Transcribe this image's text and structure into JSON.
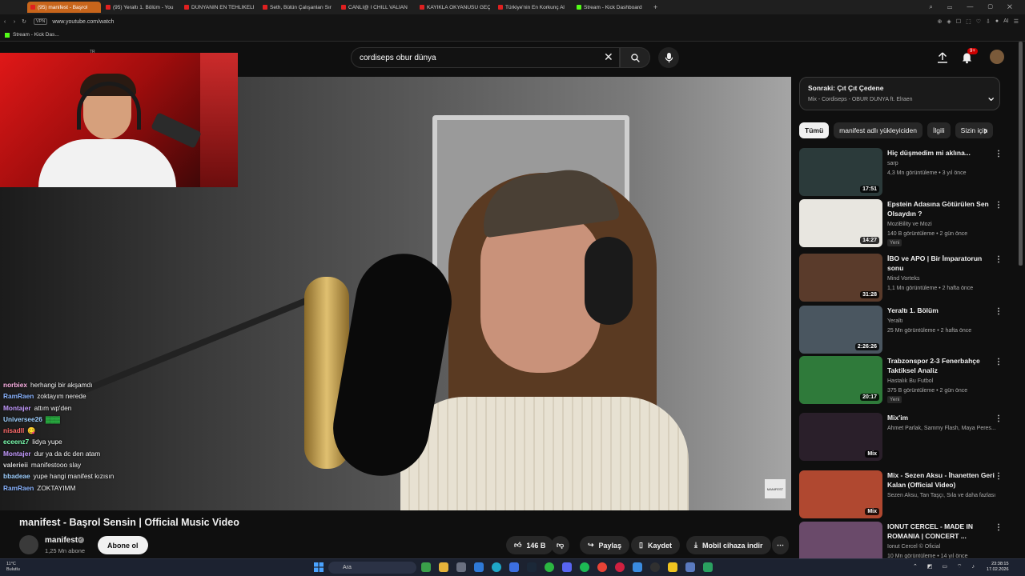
{
  "browser": {
    "tabs": [
      {
        "label": "(95) manifest - Başrol",
        "active": true,
        "favicon": "youtube-icon"
      },
      {
        "label": "(95) Yeraltı 1. Bölüm - You",
        "active": false,
        "favicon": "youtube-icon"
      },
      {
        "label": "DÜNYANIN EN TEHLİKELİ",
        "active": false,
        "favicon": "youtube-icon"
      },
      {
        "label": "Seth, Bütün Çalışanları Sır",
        "active": false,
        "favicon": "youtube-icon"
      },
      {
        "label": "CANLI@ I CHILL VALİAN",
        "active": false,
        "favicon": "youtube-icon"
      },
      {
        "label": "KAYIKLA OKYANUSU GEÇ",
        "active": false,
        "favicon": "youtube-icon"
      },
      {
        "label": "Türkiye'nin En Korkunç Al",
        "active": false,
        "favicon": "youtube-icon"
      },
      {
        "label": "Stream - Kick Dashboard",
        "active": false,
        "favicon": "kick-icon"
      }
    ],
    "vpn_label": "VPN",
    "url": "www.youtube.com/watch",
    "ai_label": "AI",
    "bookmark": "Stream - Kick Das..."
  },
  "masthead": {
    "country_code": "TR",
    "search_value": "cordiseps obur dünya",
    "notification_count": "9+"
  },
  "chat": [
    {
      "user": "norbiex",
      "color": "#ffb3e6",
      "message": "herhangi bir akşamdı"
    },
    {
      "user": "RamRaen",
      "color": "#8ab4ff",
      "message": "zoktayım nerede"
    },
    {
      "user": "Montajer",
      "color": "#c49bff",
      "message": "attım wp'den"
    },
    {
      "user": "Universee26",
      "color": "#9fd0ff",
      "message": "▓▓▓"
    },
    {
      "user": "nisadll",
      "color": "#ff6b6b",
      "message": "😋"
    },
    {
      "user": "eceenz7",
      "color": "#7cffb0",
      "message": "lidya yupe"
    },
    {
      "user": "Montajer",
      "color": "#c49bff",
      "message": "dur ya da dc den atam"
    },
    {
      "user": "valerieii",
      "color": "#d9d9d9",
      "message": "manifestooo slay"
    },
    {
      "user": "bbadeae",
      "color": "#9fd0ff",
      "message": "yupe hangi manifest kızısın"
    },
    {
      "user": "RamRaen",
      "color": "#8ab4ff",
      "message": "ZOKTAYIMM"
    }
  ],
  "video": {
    "title": "manifest - Başrol Sensin | Official Music Video",
    "watermark": "MANIFEST",
    "channel": "manifest",
    "subscribers": "1,25 Mn abone",
    "subscribe_label": "Abone ol",
    "likes": "146 B",
    "share_label": "Paylaş",
    "save_label": "Kaydet",
    "download_label": "Mobil cihaza indir"
  },
  "sidebar": {
    "next_title": "Sonraki: Çıt Çıt Çedene",
    "next_subtitle": "Mix - Cordiseps - OBUR DUNYA ft. Elraen",
    "chips": [
      "Tümü",
      "manifest adlı yükleyiciden",
      "İlgili",
      "Sizin için"
    ],
    "recommendations": [
      {
        "title": "Hiç düşmedim mi aklına...",
        "channel": "sarp",
        "meta": "4,3 Mn görüntüleme • 3 yıl önce",
        "duration": "17:51",
        "badge": "",
        "thumb": "#2b3a3a"
      },
      {
        "title": "Epstein Adasına Götürülen Sen Olsaydın ?",
        "channel": "MoziBility ve Mozi",
        "meta": "140 B görüntüleme • 2 gün önce",
        "duration": "14:27",
        "badge": "Yeni",
        "thumb": "#e8e6e0"
      },
      {
        "title": "İBO ve APO | Bir İmparatorun sonu",
        "channel": "Mind Vorteks",
        "meta": "1,1 Mn görüntüleme • 2 hafta önce",
        "duration": "31:28",
        "badge": "",
        "thumb": "#5a3b2b"
      },
      {
        "title": "Yeraltı 1. Bölüm",
        "channel": "Yeraltı",
        "meta": "25 Mn görüntüleme • 2 hafta önce",
        "duration": "2:26:26",
        "badge": "",
        "thumb": "#4a5660"
      },
      {
        "title": "Trabzonspor 2-3 Fenerbahçe Taktiksel Analiz",
        "channel": "Hastalık Bu Futbol",
        "meta": "375 B görüntüleme • 2 gün önce",
        "duration": "20:17",
        "badge": "Yeni",
        "thumb": "#2f7a3a"
      },
      {
        "title": "Mix'im",
        "channel": "Ahmet Parlak, Sammy Flash, Maya Peres...",
        "meta": "",
        "duration": "Mix",
        "badge": "",
        "thumb": "#2a1f2a"
      },
      {
        "title": "Mix - Sezen Aksu - İhanetten Geri Kalan (Official Video)",
        "channel": "Sezen Aksu, Tan Taşçı, Sıla ve daha fazlası",
        "meta": "",
        "duration": "Mix",
        "badge": "",
        "thumb": "#b04830"
      },
      {
        "title": "IONUT CERCEL - MADE IN ROMANIA | CONCERT ...",
        "channel": "Ionut Cercel © Oficial",
        "meta": "10 Mn görüntüleme • 14 yıl önce",
        "duration": "",
        "badge": "",
        "thumb": "#6a4a6a"
      }
    ]
  },
  "taskbar": {
    "weather_temp": "11°C",
    "weather_label": "Bulutlu",
    "search_placeholder": "Ara",
    "time": "23:38:15",
    "date": "17.02.2026"
  },
  "colors": {
    "accent": "#ff0000",
    "active_tab": "#c8651b",
    "kick": "#53fc18"
  }
}
